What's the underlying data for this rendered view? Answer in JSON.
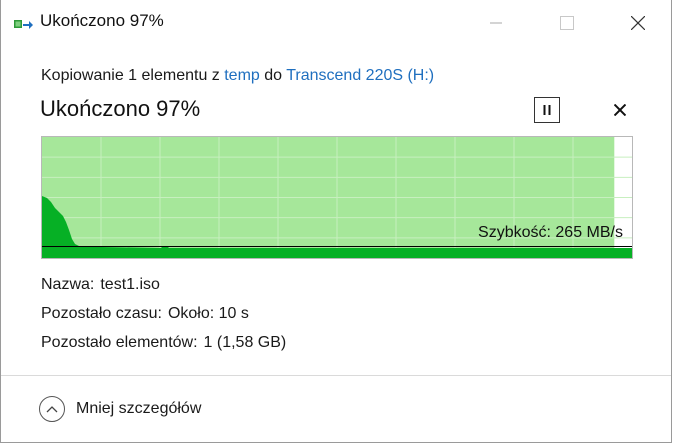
{
  "window": {
    "title": "Ukończono 97%",
    "minimize_icon": "minimize-icon",
    "maximize_icon": "maximize-icon",
    "close_icon": "close-icon"
  },
  "copy_info": {
    "prefix": "Kopiowanie 1 elementu z",
    "source": "temp",
    "middle": "do",
    "destination": "Transcend 220S (H:)"
  },
  "status": {
    "title": "Ukończono 97%",
    "progress_fraction": 0.97
  },
  "controls": {
    "pause_icon": "pause-icon",
    "cancel_icon": "cancel-icon"
  },
  "graph": {
    "speed_label": "Szybkość: 265 MB/s",
    "colors": {
      "progress_fill": "#a6e79a",
      "grid": "#c7efbf",
      "speed_area": "#06b025",
      "speed_line": "#000000"
    }
  },
  "details": {
    "name_label": "Nazwa:",
    "name_value": "test1.iso",
    "time_label": "Pozostało czasu:",
    "time_value": "Około: 10 s",
    "items_label": "Pozostało elementów:",
    "items_value": "1 (1,58 GB)"
  },
  "footer": {
    "toggle_label": "Mniej szczegółów",
    "toggle_icon": "chevron-up-icon"
  }
}
